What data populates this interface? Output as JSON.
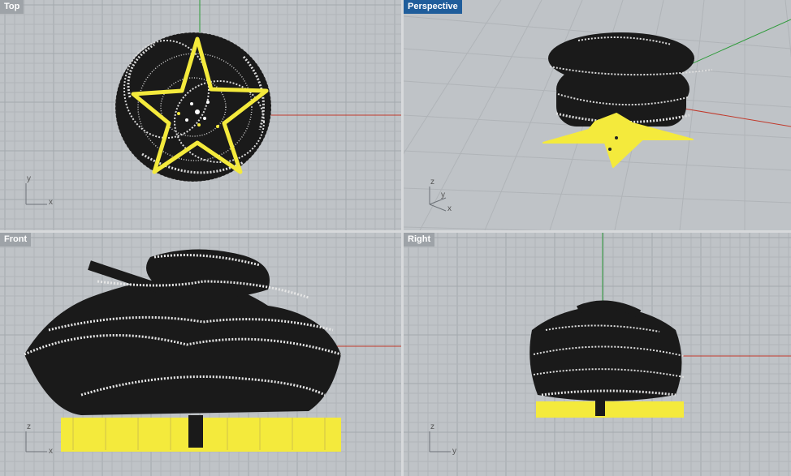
{
  "viewports": {
    "top": {
      "label": "Top",
      "active": false,
      "axis_v": "y",
      "axis_h": "x"
    },
    "perspective": {
      "label": "Perspective",
      "active": true,
      "axis_v": "z",
      "axis_a": "y",
      "axis_b": "x"
    },
    "front": {
      "label": "Front",
      "active": false,
      "axis_v": "z",
      "axis_h": "x"
    },
    "right": {
      "label": "Right",
      "active": false,
      "axis_v": "z",
      "axis_h": "y"
    }
  },
  "colors": {
    "viewport_bg": "#bfc3c7",
    "grid_minor": "#b1b5ba",
    "grid_major": "#a3a8ad",
    "x_axis": "#c0392b",
    "y_axis": "#2e9b3a",
    "mesh": "#111111",
    "selected": "#f4ea3c",
    "active_label": "#1f5d9b"
  }
}
